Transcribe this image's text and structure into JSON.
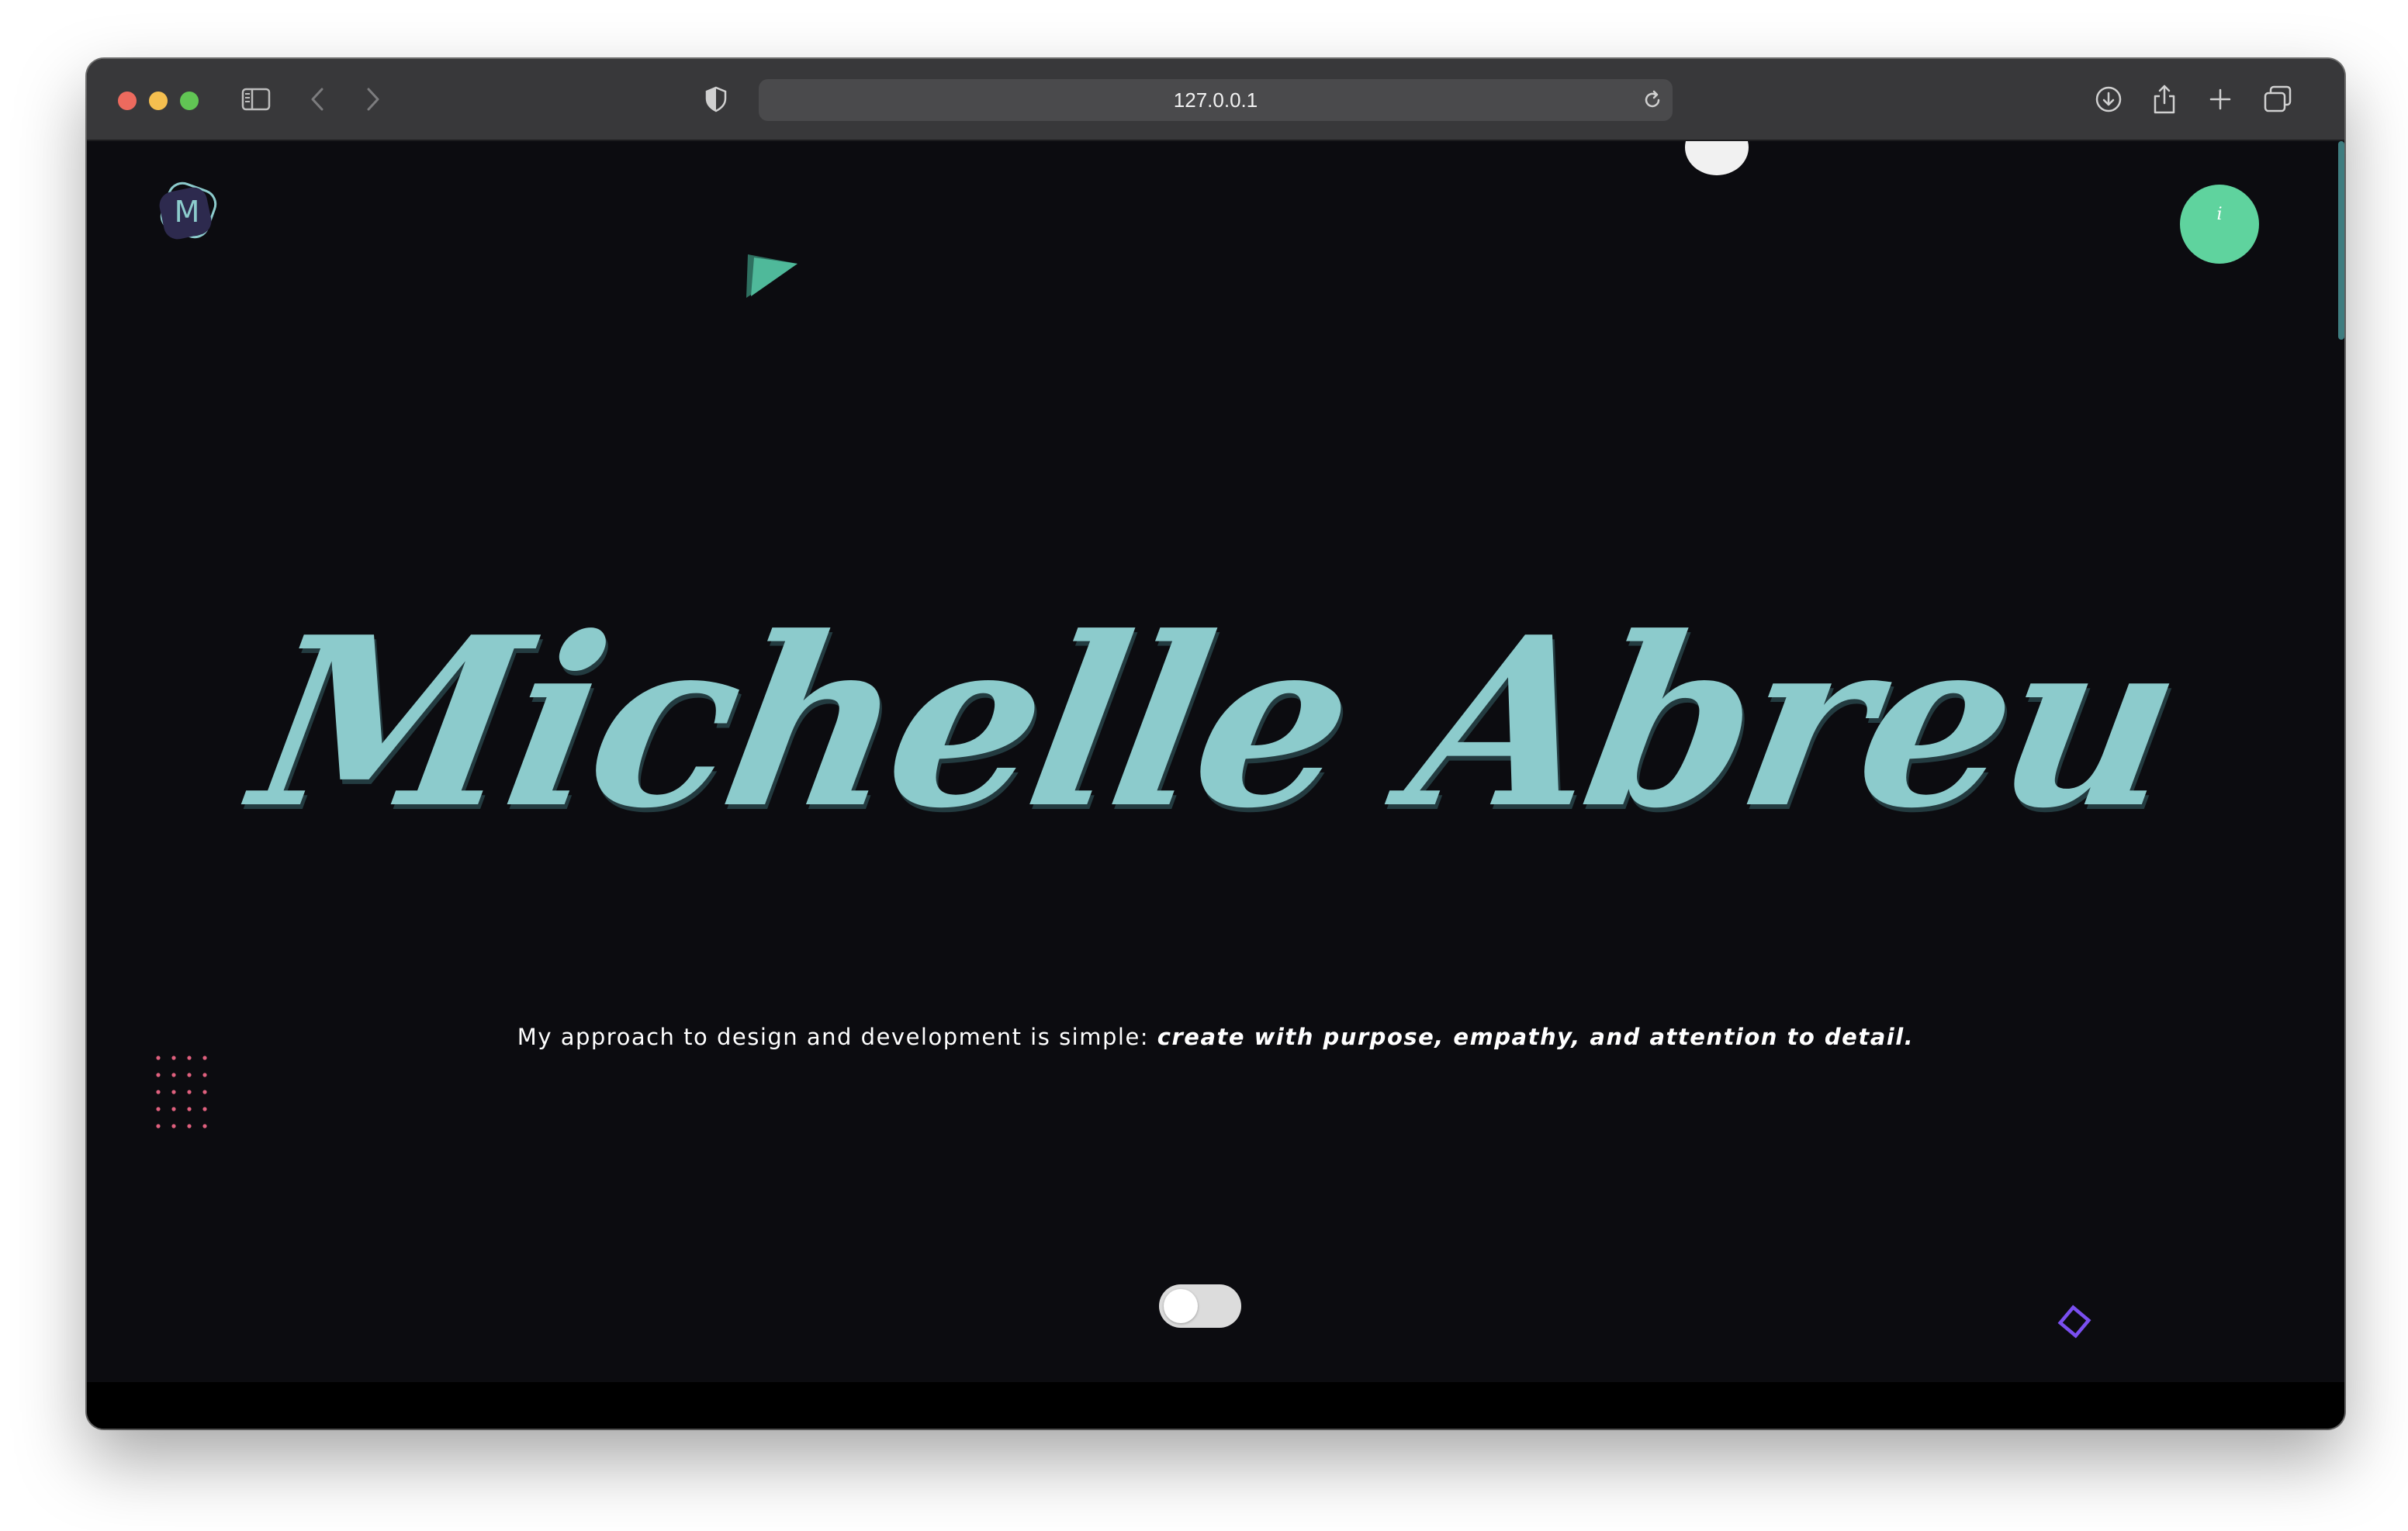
{
  "browser": {
    "url": "127.0.0.1",
    "icons": [
      "sidebar-icon",
      "back-icon",
      "forward-icon",
      "shield-icon",
      "reload-icon",
      "download-icon",
      "share-icon",
      "new-tab-icon",
      "tabs-overview-icon"
    ]
  },
  "page": {
    "logo_letter": "M",
    "info_button_label": "i",
    "hero_name": "Michelle Abreu",
    "tagline_plain": "My approach to design and development is simple: ",
    "tagline_emphasis": "create with purpose, empathy, and attention to detail.",
    "theme_toggle_on": false
  },
  "colors": {
    "page_background": "#0c0c10",
    "hero_text": "#8ccbcc",
    "info_button": "#5fd39e",
    "triangle": "#4fb99a",
    "dot_grid": "#e0607e",
    "diamond": "#7a4ff0",
    "scrollbar": "#3f7d80"
  }
}
